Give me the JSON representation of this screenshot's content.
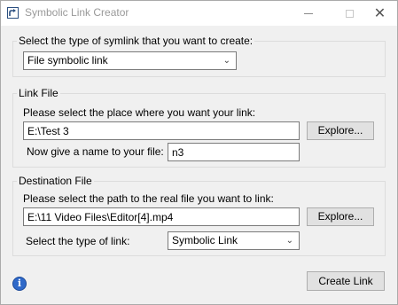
{
  "window": {
    "title": "Symbolic Link Creator",
    "controls": {
      "minimize": "—",
      "maximize": "□",
      "close": "✕"
    }
  },
  "symlink_type": {
    "prompt": "Select the type of symlink that you want to create:",
    "selected": "File symbolic link"
  },
  "link_file": {
    "group_title": "Link File",
    "place_prompt": "Please select the place where you want your link:",
    "place_value": "E:\\Test 3",
    "explore_label": "Explore...",
    "name_prompt": "Now give a name to your file:",
    "name_value": "n3"
  },
  "destination_file": {
    "group_title": "Destination File",
    "path_prompt": "Please select the path to the real file you want to link:",
    "path_value": "E:\\11 Video Files\\Editor[4].mp4",
    "explore_label": "Explore...",
    "link_type_prompt": "Select the type of link:",
    "link_type_selected": "Symbolic Link"
  },
  "footer": {
    "info_icon": "i",
    "create_label": "Create Link"
  },
  "icons": {
    "app": "shortcut-arrow-icon",
    "info": "info-icon",
    "dropdown": "chevron-down-icon"
  }
}
